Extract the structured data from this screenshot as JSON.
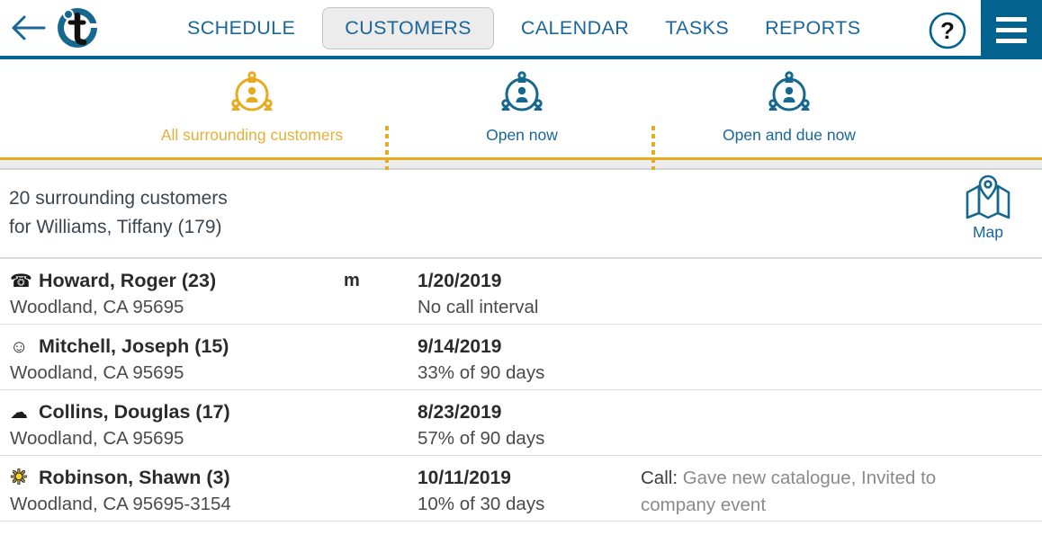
{
  "header": {
    "back_icon": "back-arrow-icon",
    "logo": "t-logo-icon",
    "tabs": [
      {
        "label": "SCHEDULE",
        "active": false
      },
      {
        "label": "CUSTOMERS",
        "active": true
      },
      {
        "label": "CALENDAR",
        "active": false
      },
      {
        "label": "TASKS",
        "active": false
      },
      {
        "label": "REPORTS",
        "active": false
      }
    ],
    "help_icon": "question-mark-icon",
    "menu_icon": "hamburger-menu-icon",
    "accent_blue": "#04628f",
    "link_blue": "#1a6699"
  },
  "filters": [
    {
      "label": "All surrounding customers",
      "icon": "surrounding-customers-icon",
      "active": true,
      "color": "#e4b03a"
    },
    {
      "label": "Open now",
      "icon": "surrounding-customers-icon",
      "active": false,
      "color": "#1a6699"
    },
    {
      "label": "Open and due now",
      "icon": "surrounding-customers-icon",
      "active": false,
      "color": "#1a6699"
    }
  ],
  "summary": {
    "line1": "20 surrounding customers",
    "line2": "for Williams, Tiffany (179)",
    "map_label": "Map",
    "map_icon": "map-pin-icon"
  },
  "customers": [
    {
      "icon": "telephone-icon",
      "icon_glyph": "☎",
      "icon_kind": "plain",
      "name": "Howard, Roger (23)",
      "address": "Woodland, CA 95695",
      "flag": "m",
      "date": "1/20/2019",
      "interval": "No call interval",
      "note_label": "",
      "note_text": ""
    },
    {
      "icon": "smiley-face-icon",
      "icon_glyph": "☺",
      "icon_kind": "plain",
      "name": "Mitchell, Joseph (15)",
      "address": "Woodland, CA 95695",
      "flag": "",
      "date": "9/14/2019",
      "interval": "33% of 90 days",
      "note_label": "",
      "note_text": ""
    },
    {
      "icon": "cloud-icon",
      "icon_glyph": "☁",
      "icon_kind": "plain",
      "name": "Collins, Douglas (17)",
      "address": "Woodland, CA 95695",
      "flag": "",
      "date": "8/23/2019",
      "interval": "57% of 90 days",
      "note_label": "",
      "note_text": ""
    },
    {
      "icon": "sun-icon",
      "icon_glyph": "☀",
      "icon_kind": "sun",
      "name": "Robinson, Shawn (3)",
      "address": "Woodland, CA 95695-3154",
      "flag": "",
      "date": "10/11/2019",
      "interval": "10% of 30 days",
      "note_label": "Call:",
      "note_text": " Gave new catalogue, Invited to company event"
    }
  ]
}
